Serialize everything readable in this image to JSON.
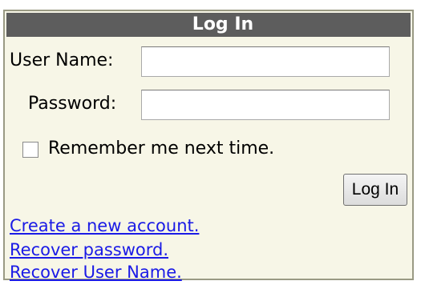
{
  "login": {
    "title": "Log In",
    "username_label": "User Name:",
    "username_value": "",
    "password_label": "Password:",
    "password_value": "",
    "remember_label": "Remember me next time.",
    "remember_checked": false,
    "login_button_label": "Log In",
    "links": {
      "create_account": "Create a new account.",
      "recover_password": "Recover password.",
      "recover_username": "Recover User Name."
    }
  },
  "colors": {
    "panel_background": "#f7f6e7",
    "title_bar": "#5d5d5d",
    "link": "#1a1ae6"
  }
}
